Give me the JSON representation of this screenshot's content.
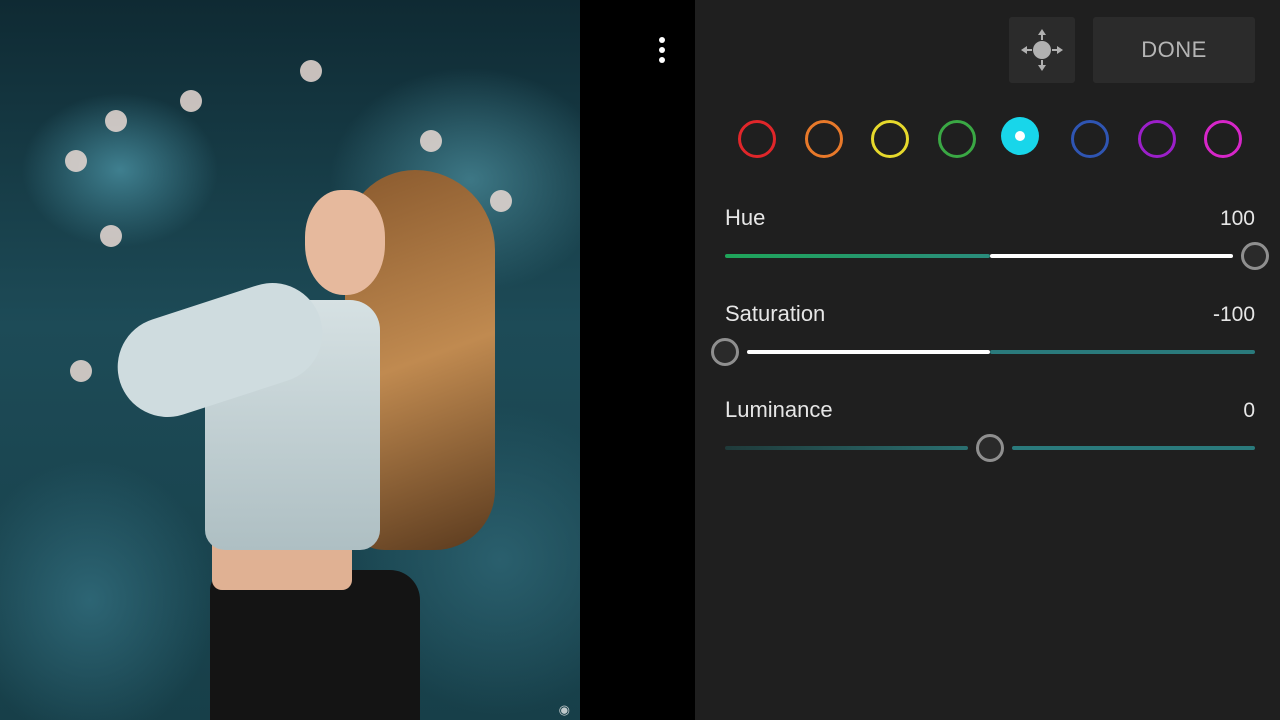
{
  "toolbar": {
    "done_label": "DONE",
    "move_icon": "move-target-icon",
    "menu_icon": "more-vertical-icon"
  },
  "color_mix": {
    "selected_index": 4,
    "swatches": [
      {
        "name": "red",
        "color": "#e0262a"
      },
      {
        "name": "orange",
        "color": "#e8792a"
      },
      {
        "name": "yellow",
        "color": "#e6d92c"
      },
      {
        "name": "green",
        "color": "#3aa844"
      },
      {
        "name": "aqua",
        "color": "#18d6ea"
      },
      {
        "name": "blue",
        "color": "#2f55b3"
      },
      {
        "name": "purple",
        "color": "#9b1fc9"
      },
      {
        "name": "magenta",
        "color": "#d726c9"
      }
    ]
  },
  "sliders": {
    "hue": {
      "label": "Hue",
      "value": "100",
      "level": 100,
      "min": -100,
      "max": 100
    },
    "saturation": {
      "label": "Saturation",
      "value": "-100",
      "level": -100,
      "min": -100,
      "max": 100
    },
    "luminance": {
      "label": "Luminance",
      "value": "0",
      "level": 0,
      "min": -100,
      "max": 100
    }
  },
  "photo": {
    "camera_icon": "camera-icon"
  },
  "colors": {
    "panel_bg": "#1f1f1f",
    "accent_teal": "#2a7a7c",
    "accent_green": "#1fa55a",
    "track_white": "#ffffff"
  }
}
